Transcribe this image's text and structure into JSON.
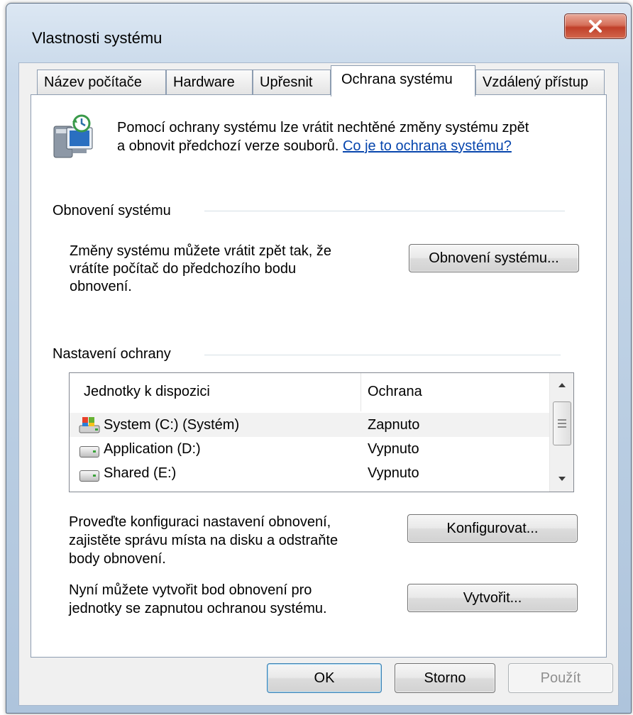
{
  "window": {
    "title": "Vlastnosti systému",
    "close_glyph": "✕"
  },
  "tabs": [
    {
      "label": "Název počítače",
      "active": false
    },
    {
      "label": "Hardware",
      "active": false
    },
    {
      "label": "Upřesnit",
      "active": false
    },
    {
      "label": "Ochrana systému",
      "active": true
    },
    {
      "label": "Vzdálený přístup",
      "active": false
    }
  ],
  "intro": {
    "icon": "system-protection-icon",
    "line1": "Pomocí ochrany systému lze vrátit nechtěné změny systému zpět",
    "line2_prefix": "a obnovit předchozí verze souborů.",
    "link": "Co je to ochrana systému?"
  },
  "restore_group": {
    "heading": "Obnovení systému",
    "description": [
      "Změny systému můžete vrátit zpět tak, že",
      "vrátíte počítač do předchozího bodu",
      "obnovení."
    ],
    "button": "Obnovení systému..."
  },
  "protection_group": {
    "heading": "Nastavení ochrany",
    "columns": [
      "Jednotky k dispozici",
      "Ochrana"
    ],
    "drives": [
      {
        "name": "System (C:) (Systém)",
        "status": "Zapnuto",
        "icon": "system-drive-icon",
        "selected": true
      },
      {
        "name": "Application (D:)",
        "status": "Vypnuto",
        "icon": "drive-icon",
        "selected": false
      },
      {
        "name": "Shared (E:)",
        "status": "Vypnuto",
        "icon": "drive-icon",
        "selected": false
      }
    ],
    "configure_text": [
      "Proveďte konfiguraci nastavení obnovení,",
      "zajistěte správu místa na disku a odstraňte",
      "body obnovení."
    ],
    "configure_button": "Konfigurovat...",
    "create_text": [
      "Nyní můžete vytvořit bod obnovení pro",
      "jednotky se zapnutou ochranou systému."
    ],
    "create_button": "Vytvořit..."
  },
  "footer": {
    "ok": "OK",
    "cancel": "Storno",
    "apply": "Použít"
  },
  "colors": {
    "link": "#0645ad",
    "close_button": "#c0402a",
    "selected_row": "#f2f2f2"
  }
}
